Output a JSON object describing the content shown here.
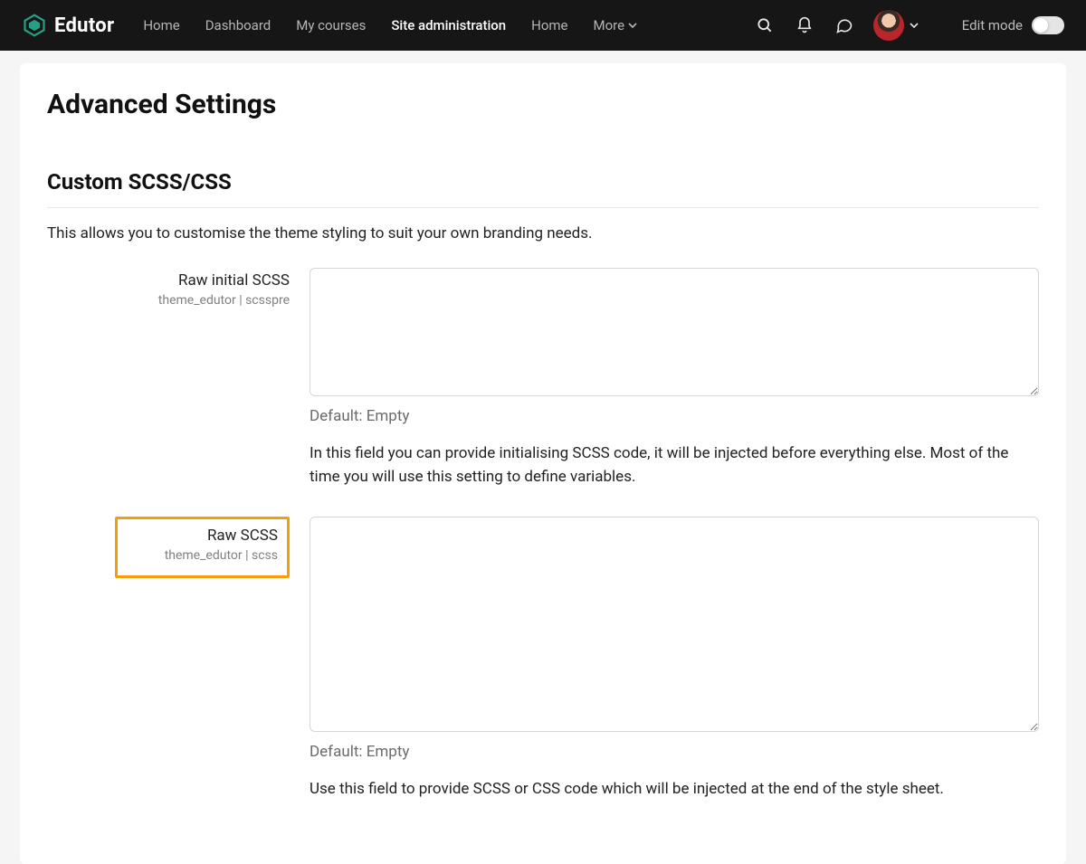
{
  "brand": {
    "name": "Edutor"
  },
  "nav": {
    "items": [
      {
        "label": "Home",
        "active": false
      },
      {
        "label": "Dashboard",
        "active": false
      },
      {
        "label": "My courses",
        "active": false
      },
      {
        "label": "Site administration",
        "active": true
      },
      {
        "label": "Home",
        "active": false
      }
    ],
    "more_label": "More"
  },
  "edit_mode": {
    "label": "Edit mode",
    "on": false
  },
  "page": {
    "title": "Advanced Settings",
    "section_title": "Custom SCSS/CSS",
    "section_desc": "This allows you to customise the theme styling to suit your own branding needs.",
    "fields": [
      {
        "label": "Raw initial SCSS",
        "id": "theme_edutor | scsspre",
        "value": "",
        "default": "Default: Empty",
        "help": "In this field you can provide initialising SCSS code, it will be injected before everything else. Most of the time you will use this setting to define variables."
      },
      {
        "label": "Raw SCSS",
        "id": "theme_edutor | scss",
        "value": "",
        "default": "Default: Empty",
        "help": "Use this field to provide SCSS or CSS code which will be injected at the end of the style sheet."
      }
    ]
  }
}
